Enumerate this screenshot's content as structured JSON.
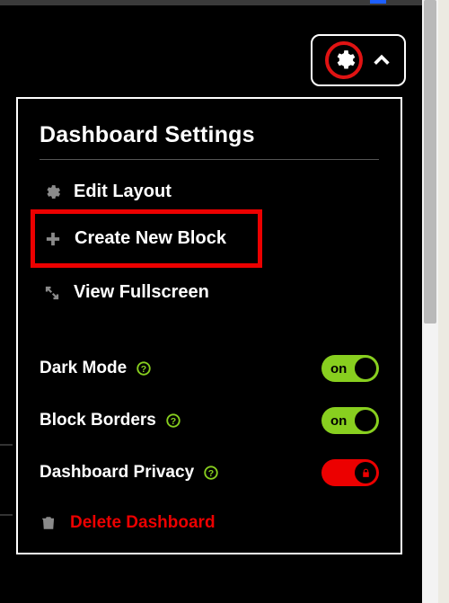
{
  "header": {},
  "panel": {
    "title": "Dashboard Settings",
    "items": {
      "edit_layout": "Edit Layout",
      "create_block": "Create New Block",
      "view_fullscreen": "View Fullscreen"
    },
    "toggles": {
      "dark_mode": {
        "label": "Dark Mode",
        "state": "on"
      },
      "block_borders": {
        "label": "Block Borders",
        "state": "on"
      },
      "dashboard_privacy": {
        "label": "Dashboard Privacy",
        "state": "locked"
      }
    },
    "delete": "Delete Dashboard"
  },
  "highlights": {
    "gear_circle": true,
    "create_block_box": true
  },
  "colors": {
    "accent_green": "#88cf1f",
    "accent_red": "#ec0000"
  }
}
